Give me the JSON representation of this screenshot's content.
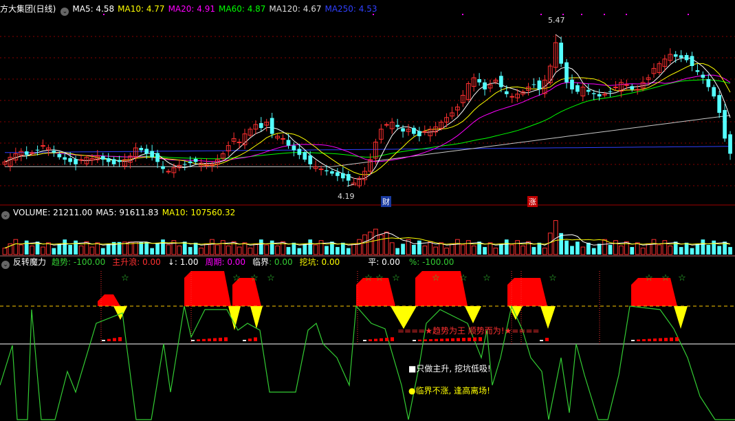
{
  "colors": {
    "up": "#ff3030",
    "down": "#54ffff",
    "ma5": "#ffffff",
    "ma10": "#ffff00",
    "ma20": "#ff00ff",
    "ma60": "#00ff00",
    "ma120": "#c8c8c8",
    "ma250": "#3040ff",
    "divider": "#a00000",
    "grid": "#8a0000",
    "trend_line": "#33cc33",
    "dashed_level": "#ffcc00",
    "fill_red": "#ff0000",
    "fill_yellow": "#ffff00"
  },
  "price_panel": {
    "title": "方大集团(日线)",
    "legend": [
      {
        "key": "ma5",
        "text": "MA5: 4.58"
      },
      {
        "key": "ma10",
        "text": "MA10: 4.77"
      },
      {
        "key": "ma20",
        "text": "MA20: 4.91"
      },
      {
        "key": "ma60",
        "text": "MA60: 4.87"
      },
      {
        "key": "ma120",
        "text": "MA120: 4.67"
      },
      {
        "key": "ma250",
        "text": "MA250: 4.53"
      }
    ],
    "high_label": "5.47",
    "low_label": "4.19",
    "badges": [
      "财",
      "涨"
    ]
  },
  "volume_panel": {
    "legend": [
      {
        "key": "vol",
        "text": "VOLUME: 21211.00"
      },
      {
        "key": "ma5",
        "text": "MA5: 91611.83"
      },
      {
        "key": "ma10",
        "text": "MA10: 107560.32"
      }
    ]
  },
  "indicator_panel": {
    "title": "反转魔力",
    "legend": [
      {
        "label": "趋势",
        "value": ": -100.00",
        "color": "#33cc33"
      },
      {
        "label": "主升浪",
        "value": ": 0.00",
        "color": "#ff3030"
      },
      {
        "label": "↓",
        "value": ": 1.00",
        "color": "#ffffff"
      },
      {
        "label": "周期",
        "value": ": 0.00",
        "color": "#ff00ff"
      },
      {
        "label": "临界",
        "value": ": 0.00",
        "color": "#ffffff"
      },
      {
        "label": "挖坑",
        "value": ": 0.00",
        "color": "#ffff00"
      },
      {
        "label": "平",
        "value": ": 0.00",
        "color": "#ffffff"
      },
      {
        "label": "%",
        "value": ": -100.00",
        "color": "#33cc33"
      }
    ],
    "banner": "====★趋势为王 顺势而为!★====",
    "note1": "■只做主升, 挖坑低吸!",
    "note2": "●临界不涨, 逢高离场!"
  },
  "chart_data": [
    {
      "type": "candlestick",
      "title": "方大集团(日线)",
      "ylim": [
        4.1,
        5.6
      ],
      "annotations": [
        {
          "text": "5.47",
          "kind": "high"
        },
        {
          "text": "4.19",
          "kind": "low"
        }
      ],
      "series_closes": [
        4.38,
        4.42,
        4.45,
        4.47,
        4.44,
        4.46,
        4.48,
        4.52,
        4.5,
        4.46,
        4.42,
        4.4,
        4.38,
        4.36,
        4.4,
        4.42,
        4.41,
        4.43,
        4.4,
        4.38,
        4.36,
        4.38,
        4.4,
        4.43,
        4.5,
        4.48,
        4.45,
        4.42,
        4.38,
        4.32,
        4.3,
        4.33,
        4.35,
        4.36,
        4.37,
        4.38,
        4.37,
        4.36,
        4.36,
        4.4,
        4.45,
        4.52,
        4.58,
        4.55,
        4.62,
        4.66,
        4.7,
        4.67,
        4.72,
        4.62,
        4.6,
        4.58,
        4.52,
        4.48,
        4.44,
        4.4,
        4.36,
        4.34,
        4.32,
        4.3,
        4.28,
        4.26,
        4.24,
        4.22,
        4.2,
        4.24,
        4.3,
        4.4,
        4.55,
        4.66,
        4.7,
        4.72,
        4.68,
        4.64,
        4.66,
        4.62,
        4.6,
        4.64,
        4.66,
        4.68,
        4.72,
        4.76,
        4.8,
        4.85,
        4.95,
        5.05,
        5.1,
        5.06,
        5.0,
        5.04,
        5.08,
        5.02,
        4.96,
        4.94,
        4.96,
        4.98,
        5.02,
        5.04,
        5.0,
        5.08,
        5.2,
        5.4,
        5.22,
        5.06,
        5.0,
        4.98,
        5.02,
        4.98,
        4.96,
        4.94,
        4.96,
        4.98,
        5.02,
        5.06,
        5.04,
        5.0,
        5.0,
        5.06,
        5.1,
        5.18,
        5.22,
        5.26,
        5.3,
        5.28,
        5.27,
        5.25,
        5.2,
        5.15,
        5.1,
        5.02,
        4.94,
        4.8,
        4.58,
        4.45
      ]
    },
    {
      "type": "bar",
      "title": "VOLUME",
      "values": [
        21211,
        91611.83,
        107560.32
      ],
      "categories": [
        "VOLUME",
        "MA5",
        "MA10"
      ]
    },
    {
      "type": "line",
      "title": "反转魔力",
      "series": [
        {
          "name": "趋势",
          "values": [
            -100
          ]
        },
        {
          "name": "主升浪",
          "values": [
            0
          ]
        },
        {
          "name": "%",
          "values": [
            -100
          ]
        }
      ],
      "ylim": [
        -100,
        100
      ]
    }
  ]
}
